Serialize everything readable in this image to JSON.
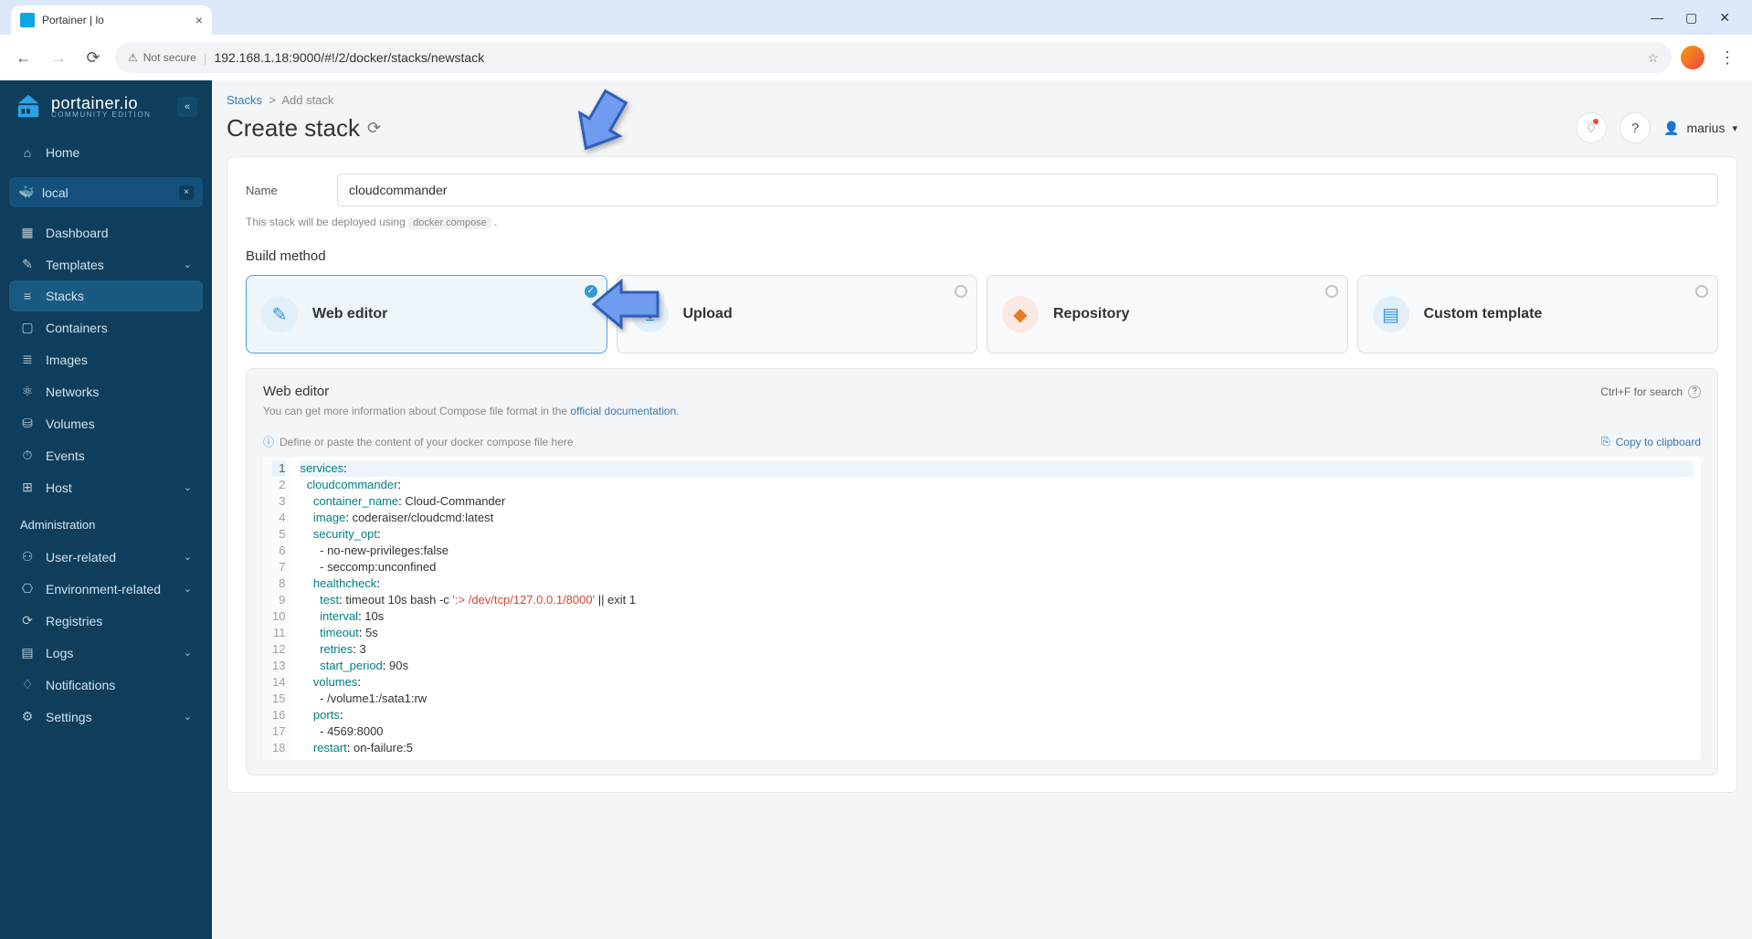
{
  "browser": {
    "tab_title": "Portainer | lo",
    "not_secure": "Not secure",
    "url": "192.168.1.18:9000/#!/2/docker/stacks/newstack"
  },
  "brand": {
    "name": "portainer.io",
    "edition": "COMMUNITY EDITION"
  },
  "sidebar": {
    "home": "Home",
    "env_name": "local",
    "items": [
      {
        "icon": "▦",
        "label": "Dashboard"
      },
      {
        "icon": "✎",
        "label": "Templates",
        "chevron": true
      },
      {
        "icon": "≡",
        "label": "Stacks",
        "active": true
      },
      {
        "icon": "▢",
        "label": "Containers"
      },
      {
        "icon": "≣",
        "label": "Images"
      },
      {
        "icon": "⚛",
        "label": "Networks"
      },
      {
        "icon": "⛁",
        "label": "Volumes"
      },
      {
        "icon": "⏱",
        "label": "Events"
      },
      {
        "icon": "⊞",
        "label": "Host",
        "chevron": true
      }
    ],
    "admin_heading": "Administration",
    "admin_items": [
      {
        "icon": "⚇",
        "label": "User-related",
        "chevron": true
      },
      {
        "icon": "⎔",
        "label": "Environment-related",
        "chevron": true
      },
      {
        "icon": "⟳",
        "label": "Registries"
      },
      {
        "icon": "▤",
        "label": "Logs",
        "chevron": true
      },
      {
        "icon": "♢",
        "label": "Notifications"
      },
      {
        "icon": "⚙",
        "label": "Settings",
        "chevron": true
      }
    ]
  },
  "breadcrumb": {
    "root": "Stacks",
    "sep": ">",
    "leaf": "Add stack"
  },
  "page_title": "Create stack",
  "user_name": "marius",
  "form": {
    "name_label": "Name",
    "name_value": "cloudcommander",
    "deploy_hint_pre": "This stack will be deployed using ",
    "deploy_hint_code": "docker compose",
    "build_method_title": "Build method"
  },
  "methods": [
    {
      "label": "Web editor",
      "color": "blue",
      "selected": true,
      "glyph": "✎"
    },
    {
      "label": "Upload",
      "color": "blue",
      "selected": false,
      "glyph": "⤓"
    },
    {
      "label": "Repository",
      "color": "orange",
      "selected": false,
      "glyph": "◆"
    },
    {
      "label": "Custom template",
      "color": "blue",
      "selected": false,
      "glyph": "▤"
    }
  ],
  "editor": {
    "title": "Web editor",
    "search_hint": "Ctrl+F for search",
    "info_pre": "You can get more information about Compose file format in the ",
    "info_link": "official documentation",
    "define_hint": "Define or paste the content of your docker compose file here",
    "copy_label": "Copy to clipboard"
  },
  "code": {
    "lines": [
      {
        "n": 1,
        "indent": 0,
        "key": "services",
        "val": "",
        "active": true
      },
      {
        "n": 2,
        "indent": 1,
        "key": "cloudcommander",
        "val": ""
      },
      {
        "n": 3,
        "indent": 2,
        "key": "container_name",
        "val": " Cloud-Commander"
      },
      {
        "n": 4,
        "indent": 2,
        "key": "image",
        "val": " coderaiser/cloudcmd:latest"
      },
      {
        "n": 5,
        "indent": 2,
        "key": "security_opt",
        "val": ""
      },
      {
        "n": 6,
        "indent": 3,
        "plain": "- no-new-privileges:false"
      },
      {
        "n": 7,
        "indent": 3,
        "plain": "- seccomp:unconfined"
      },
      {
        "n": 8,
        "indent": 2,
        "key": "healthcheck",
        "val": ""
      },
      {
        "n": 9,
        "indent": 3,
        "key": "test",
        "val": " timeout 10s bash -c ",
        "str": "':> /dev/tcp/127.0.0.1/8000'",
        "tail": " || exit 1"
      },
      {
        "n": 10,
        "indent": 3,
        "key": "interval",
        "val": " 10s"
      },
      {
        "n": 11,
        "indent": 3,
        "key": "timeout",
        "val": " 5s"
      },
      {
        "n": 12,
        "indent": 3,
        "key": "retries",
        "val": " 3"
      },
      {
        "n": 13,
        "indent": 3,
        "key": "start_period",
        "val": " 90s"
      },
      {
        "n": 14,
        "indent": 2,
        "key": "volumes",
        "val": ""
      },
      {
        "n": 15,
        "indent": 3,
        "plain": "- /volume1:/sata1:rw"
      },
      {
        "n": 16,
        "indent": 2,
        "key": "ports",
        "val": ""
      },
      {
        "n": 17,
        "indent": 3,
        "plain": "- 4569:8000"
      },
      {
        "n": 18,
        "indent": 2,
        "key": "restart",
        "val": " on-failure:5"
      }
    ]
  }
}
